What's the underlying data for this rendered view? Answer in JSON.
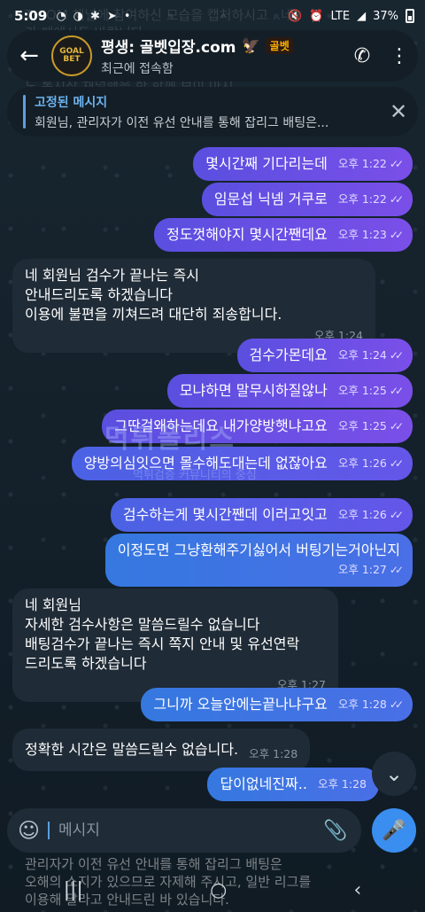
{
  "status": {
    "time": "5:09",
    "battery": "37%",
    "network": "LTE"
  },
  "header": {
    "title": "평생: 골벳입장.com",
    "badge": "골벳",
    "subtitle": "최근에 접속함",
    "avatar_text": "GOAL BET"
  },
  "pinned": {
    "title": "고정된 메시지",
    "body": "회원님, 관리자가 이전 유선 안내를 통해 잡리그 배팅은..."
  },
  "background_text": [
    "TICOM 채널에 참여하신 모습을 캡처하시고 ..네",
    "가 페에시도 바랍니다",
    "도 통시작 채널했을 한 함께 보이 마시"
  ],
  "messages": [
    {
      "dir": "out",
      "text": "몇시간째 기다리는데",
      "time": "오후 1:22"
    },
    {
      "dir": "out",
      "text": "임문섭 닉넴 거쿠로",
      "time": "오후 1:22"
    },
    {
      "dir": "out",
      "text": "정도껏해야지 몇시간짼데요",
      "time": "오후 1:23"
    },
    {
      "dir": "in",
      "text": "네 회원님 검수가 끝나는 즉시\n안내드리도록 하겠습니다\n이용에 불편을 끼쳐드려 대단히 죄송합니다.",
      "time": "오후 1:24"
    },
    {
      "dir": "out",
      "text": "검수가몬데요",
      "time": "오후 1:24"
    },
    {
      "dir": "out",
      "text": "모냐하면 말무시하질않나",
      "time": "오후 1:25"
    },
    {
      "dir": "out",
      "text": "그딴걸왜하는데요 내가양방햇냐고요",
      "time": "오후 1:25"
    },
    {
      "dir": "out",
      "text": "양방의심잇으면 몰수해도대는데 없잖아요",
      "time": "오후 1:26"
    },
    {
      "dir": "out",
      "text": "검수하는게 몇시간짼데 이러고잇고",
      "time": "오후 1:26"
    },
    {
      "dir": "out",
      "text": "이정도면 그냥환해주기싫어서 버팅기는거아닌지",
      "time": "오후 1:27"
    },
    {
      "dir": "in",
      "text": "네 회원님\n자세한 검수사항은 말씀드릴수 없습니다\n배팅검수가 끝나는 즉시 쪽지 안내 및 유선연락\n드리도록 하겠습니다",
      "time": "오후 1:27"
    },
    {
      "dir": "out",
      "text": "그니까 오늘안에는끝나냐구요",
      "time": "오후 1:28"
    },
    {
      "dir": "in",
      "text": "정확한 시간은 말씀드릴수 없습니다.",
      "time": "오후 1:28"
    },
    {
      "dir": "out",
      "text": "답이없네진짜..",
      "time": "오후 1:28"
    }
  ],
  "watermark": {
    "main": "먹튀폴리스",
    "sub": "먹튀검증 커뮤니티의 중심"
  },
  "composer": {
    "placeholder": "메시지"
  },
  "bottom_text": [
    "관리자가 이전 유선 안내를 통해 잡리그 배팅은",
    "오해의 소지가 있으므로 자제해 주시고, 일반 리그를",
    "이용해 달라고 안내드린 바 있습니다."
  ],
  "nav": {
    "recent": "|||",
    "home": "○",
    "back": "‹"
  },
  "colors": {
    "outgoing_bubble": "#6a4fe6",
    "incoming_bubble": "#1f2b36",
    "accent": "#3a8ef0"
  }
}
